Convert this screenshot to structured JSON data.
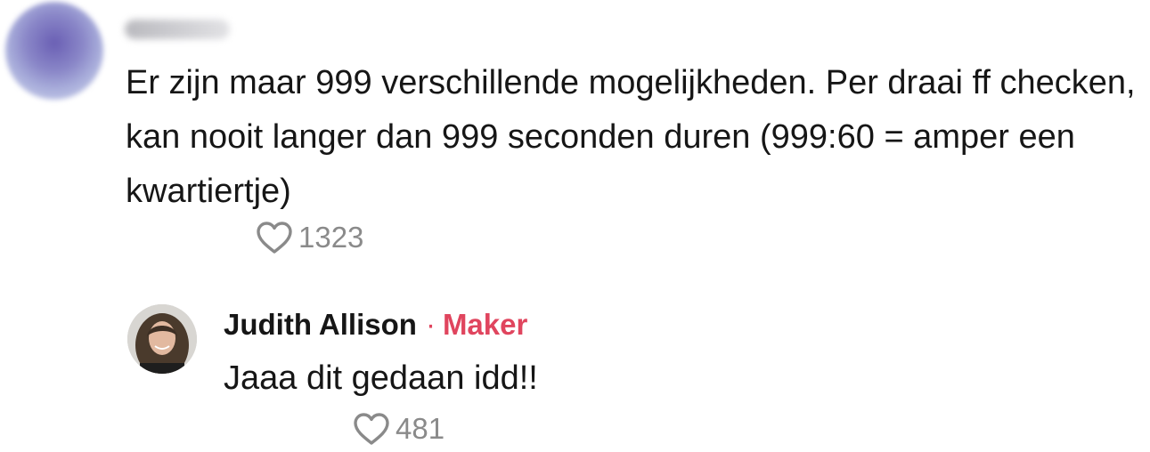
{
  "comment": {
    "username": "",
    "text": "Er zijn maar 999 verschillende mogelijkheden. Per draai ff checken, kan nooit langer dan 999 seconden duren (999:60 = amper een kwartiertje)",
    "likes": "1323",
    "like_icon": "heart-outline-icon"
  },
  "reply": {
    "author": "Judith Allison",
    "separator": "·",
    "badge": "Maker",
    "text": "Jaaa dit gedaan idd!!",
    "likes": "481",
    "like_icon": "heart-outline-icon"
  },
  "colors": {
    "badge": "#e0455e",
    "text": "#161616",
    "muted": "#8a8a8a"
  }
}
